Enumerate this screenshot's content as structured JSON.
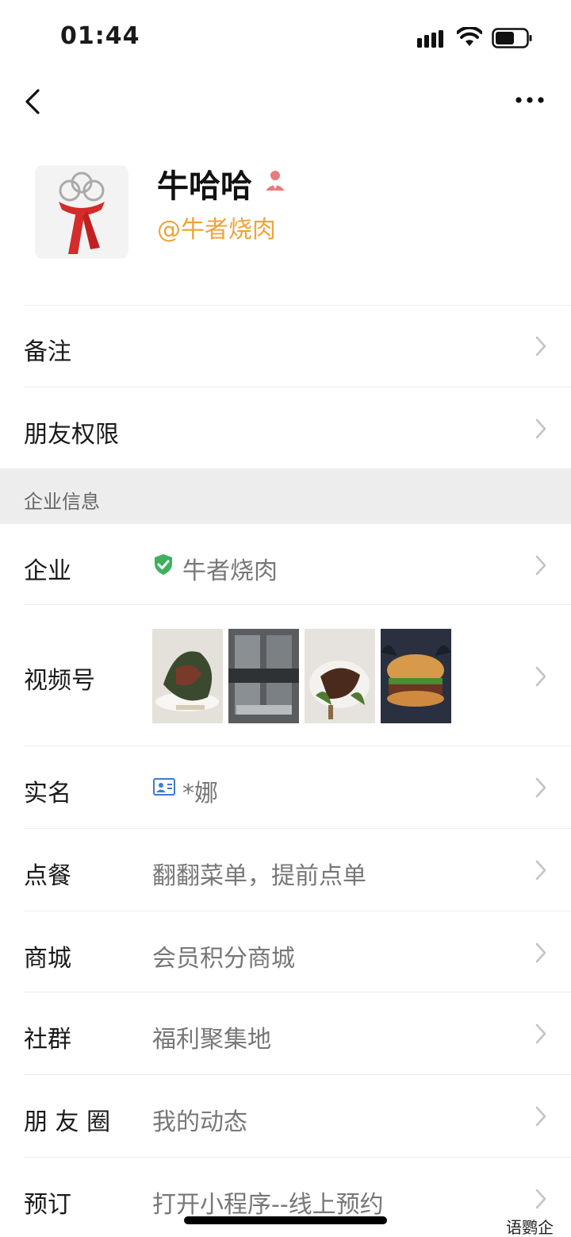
{
  "status_bar": {
    "time": "01:44"
  },
  "profile": {
    "name": "牛哈哈",
    "company_handle": "@牛者烧肉"
  },
  "rows": {
    "remark": {
      "label": "备注"
    },
    "friend_permission": {
      "label": "朋友权限"
    }
  },
  "section": {
    "enterprise_info": "企业信息"
  },
  "enterprise": {
    "company": {
      "label": "企业",
      "value": "牛者烧肉"
    },
    "video": {
      "label": "视频号"
    },
    "real_name": {
      "label": "实名",
      "value": "*娜"
    },
    "order": {
      "label": "点餐",
      "value": "翻翻菜单，提前点单"
    },
    "mall": {
      "label": "商城",
      "value": "会员积分商城"
    },
    "community": {
      "label": "社群",
      "value": "福利聚集地"
    },
    "moments": {
      "label": "朋 友 圈",
      "value": "我的动态"
    },
    "booking": {
      "label": "预订",
      "value": "打开小程序--线上预约"
    }
  },
  "watermark": {
    "corner": "语鹦企服"
  },
  "colors": {
    "accent_orange": "#f0a33a",
    "verified_green": "#3fb060",
    "idcard_blue": "#3a7bd5",
    "section_bg": "#ededed"
  }
}
